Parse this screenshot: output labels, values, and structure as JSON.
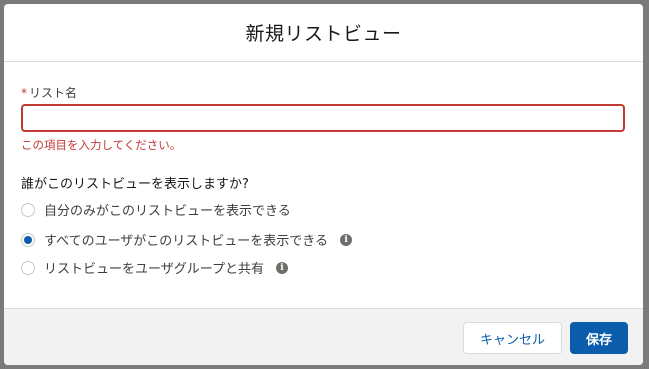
{
  "modal": {
    "title": "新規リストビュー"
  },
  "form": {
    "list_name": {
      "required_mark": "*",
      "label": "リスト名",
      "value": "",
      "error": "この項目を入力してください。"
    },
    "visibility": {
      "legend": "誰がこのリストビューを表示しますか?",
      "options": [
        {
          "label": "自分のみがこのリストビューを表示できる",
          "checked": false,
          "has_info": false
        },
        {
          "label": "すべてのユーザがこのリストビューを表示できる",
          "checked": true,
          "has_info": true
        },
        {
          "label": "リストビューをユーザグループと共有",
          "checked": false,
          "has_info": true
        }
      ]
    }
  },
  "footer": {
    "cancel_label": "キャンセル",
    "save_label": "保存"
  },
  "colors": {
    "error": "#c23934",
    "brand": "#0b5cab",
    "footer_bg": "#f3f2f2"
  },
  "icons": {
    "info": "info-icon"
  }
}
